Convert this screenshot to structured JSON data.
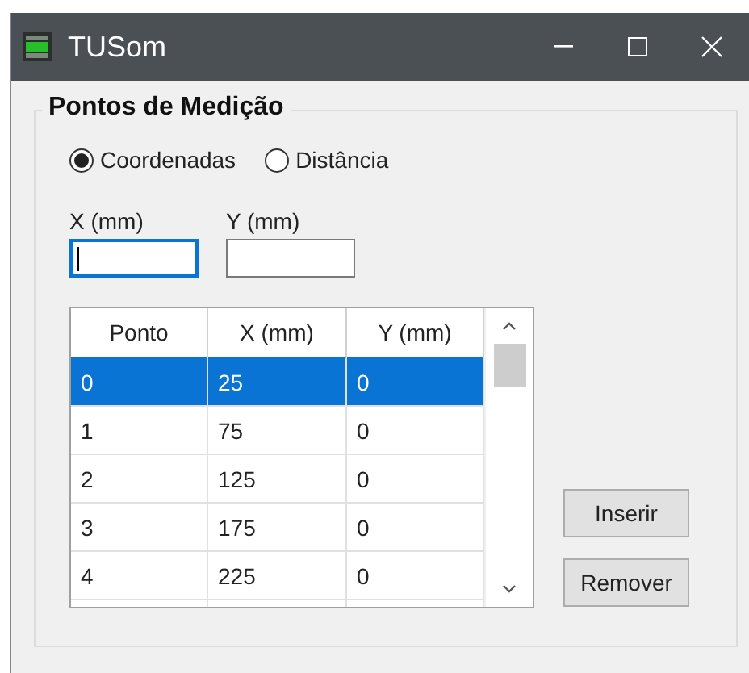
{
  "window": {
    "title": "TUSom"
  },
  "group": {
    "title": "Pontos de Medição"
  },
  "radios": [
    {
      "label": "Coordenadas",
      "selected": true
    },
    {
      "label": "Distância",
      "selected": false
    }
  ],
  "fields": [
    {
      "label": "X (mm)",
      "focused": true
    },
    {
      "label": "Y (mm)",
      "focused": false
    }
  ],
  "table": {
    "columns": [
      "Ponto",
      "X (mm)",
      "Y (mm)"
    ],
    "rows": [
      {
        "cells": [
          "0",
          "25",
          "0"
        ],
        "selected": true
      },
      {
        "cells": [
          "1",
          "75",
          "0"
        ],
        "selected": false
      },
      {
        "cells": [
          "2",
          "125",
          "0"
        ],
        "selected": false
      },
      {
        "cells": [
          "3",
          "175",
          "0"
        ],
        "selected": false
      },
      {
        "cells": [
          "4",
          "225",
          "0"
        ],
        "selected": false
      }
    ]
  },
  "buttons": [
    "Inserir",
    "Remover"
  ]
}
